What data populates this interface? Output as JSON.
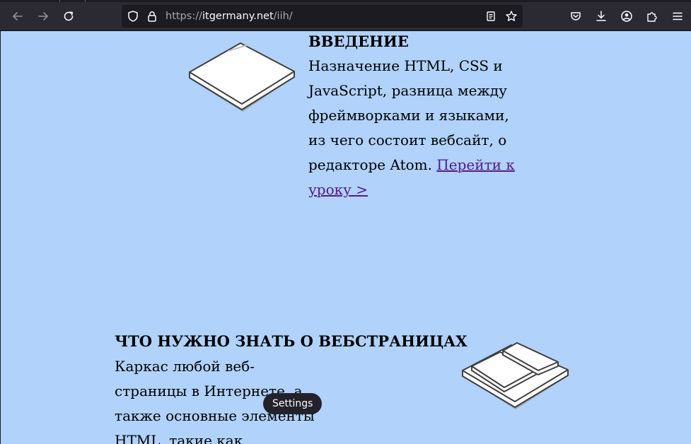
{
  "browser": {
    "back_icon": "arrow-left-icon",
    "forward_icon": "arrow-right-icon",
    "reload_icon": "reload-icon",
    "url": {
      "scheme": "https://",
      "host": "itgermany.net",
      "path": "/iih/"
    },
    "url_icons": [
      "shield-icon",
      "lock-icon",
      "reader-view-icon",
      "bookmark-star-icon"
    ],
    "toolbar_icons": [
      "pocket-icon",
      "download-icon",
      "account-icon",
      "extensions-icon",
      "menu-icon"
    ]
  },
  "sections": [
    {
      "title": "ВВЕДЕНИЕ",
      "body": "Назначение HTML, CSS и JavaScript, разница между фреймворками и языками, из чего состоит вебсайт, о редакторе Atom.",
      "link": "Перейти к уроку >"
    },
    {
      "title": "ЧТО НУЖНО ЗНАТЬ О ВЕБСТРАНИЦАХ",
      "body": "Каркас любой веб-страницы в Интернете, а также основные элементы HTML, такие как"
    }
  ],
  "overlay": {
    "settings_label": "Settings"
  },
  "colors": {
    "page_background": "#b0d2fb",
    "toolbar_background": "#2b2a33",
    "urlbar_background": "#1c1b22",
    "link": "#551a8b"
  }
}
